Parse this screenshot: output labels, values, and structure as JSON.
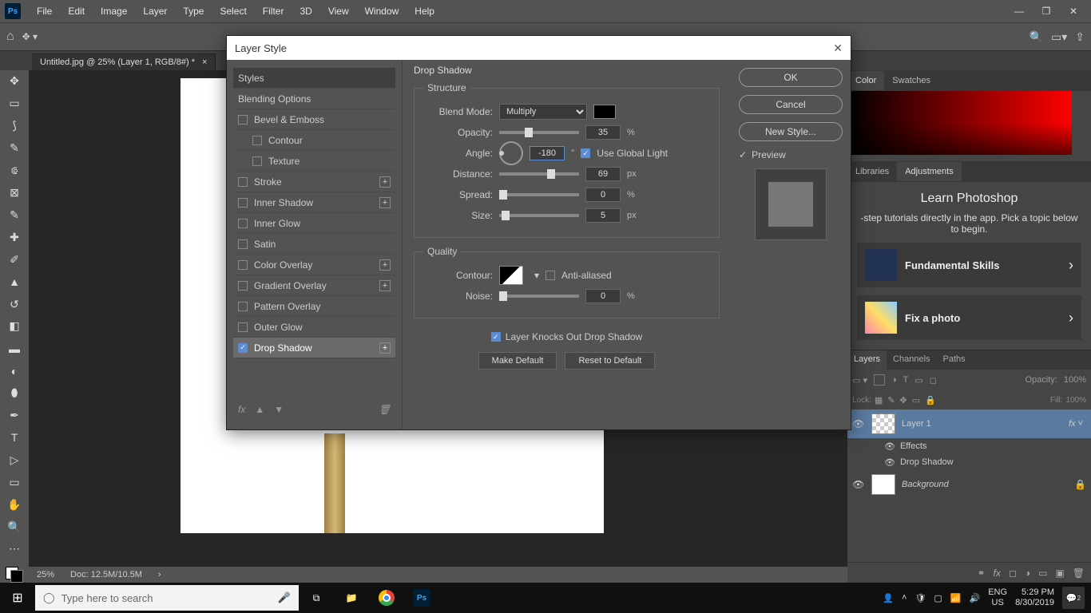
{
  "menubar": [
    "File",
    "Edit",
    "Image",
    "Layer",
    "Type",
    "Select",
    "Filter",
    "3D",
    "View",
    "Window",
    "Help"
  ],
  "tab": {
    "title": "Untitled.jpg @ 25% (Layer 1, RGB/8#) *"
  },
  "status": {
    "zoom": "25%",
    "docsize": "Doc: 12.5M/10.5M"
  },
  "dialog": {
    "title": "Layer Style",
    "styles_label": "Styles",
    "blending_label": "Blending Options",
    "effects": {
      "bevel": "Bevel & Emboss",
      "contour": "Contour",
      "texture": "Texture",
      "stroke": "Stroke",
      "innershadow": "Inner Shadow",
      "innerglow": "Inner Glow",
      "satin": "Satin",
      "coloroverlay": "Color Overlay",
      "gradientoverlay": "Gradient Overlay",
      "patternoverlay": "Pattern Overlay",
      "outerglow": "Outer Glow",
      "dropshadow": "Drop Shadow"
    },
    "section_title": "Drop Shadow",
    "structure": {
      "legend": "Structure",
      "blendmode_label": "Blend Mode:",
      "blendmode_value": "Multiply",
      "opacity_label": "Opacity:",
      "opacity_value": "35",
      "angle_label": "Angle:",
      "angle_value": "-180",
      "angle_unit": "°",
      "use_global": "Use Global Light",
      "distance_label": "Distance:",
      "distance_value": "69",
      "spread_label": "Spread:",
      "spread_value": "0",
      "size_label": "Size:",
      "size_value": "5",
      "px": "px",
      "pct": "%"
    },
    "quality": {
      "legend": "Quality",
      "contour_label": "Contour:",
      "antialiased": "Anti-aliased",
      "noise_label": "Noise:",
      "noise_value": "0"
    },
    "knockout": "Layer Knocks Out Drop Shadow",
    "make_default": "Make Default",
    "reset_default": "Reset to Default",
    "ok": "OK",
    "cancel": "Cancel",
    "newstyle": "New Style...",
    "preview": "Preview"
  },
  "rightpanels": {
    "tabs1": [
      "Color",
      "Swatches"
    ],
    "tabs2": [
      "Libraries",
      "Adjustments"
    ],
    "learn_title": "Learn Photoshop",
    "learn_sub": "-step tutorials directly in the app. Pick a topic below to begin.",
    "card1": "Fundamental Skills",
    "card2": "Fix a photo",
    "layertabs": [
      "Layers",
      "Channels",
      "Paths"
    ],
    "opacity_label": "Opacity:",
    "opacity_value": "100%",
    "lock_label": "Lock:",
    "fill_label": "Fill:",
    "fill_value": "100%",
    "layer1": "Layer 1",
    "effects": "Effects",
    "dropshadow": "Drop Shadow",
    "background": "Background"
  },
  "taskbar": {
    "search_placeholder": "Type here to search",
    "lang1": "ENG",
    "lang2": "US",
    "time": "5:29 PM",
    "date": "8/30/2019",
    "notif_count": "2"
  }
}
